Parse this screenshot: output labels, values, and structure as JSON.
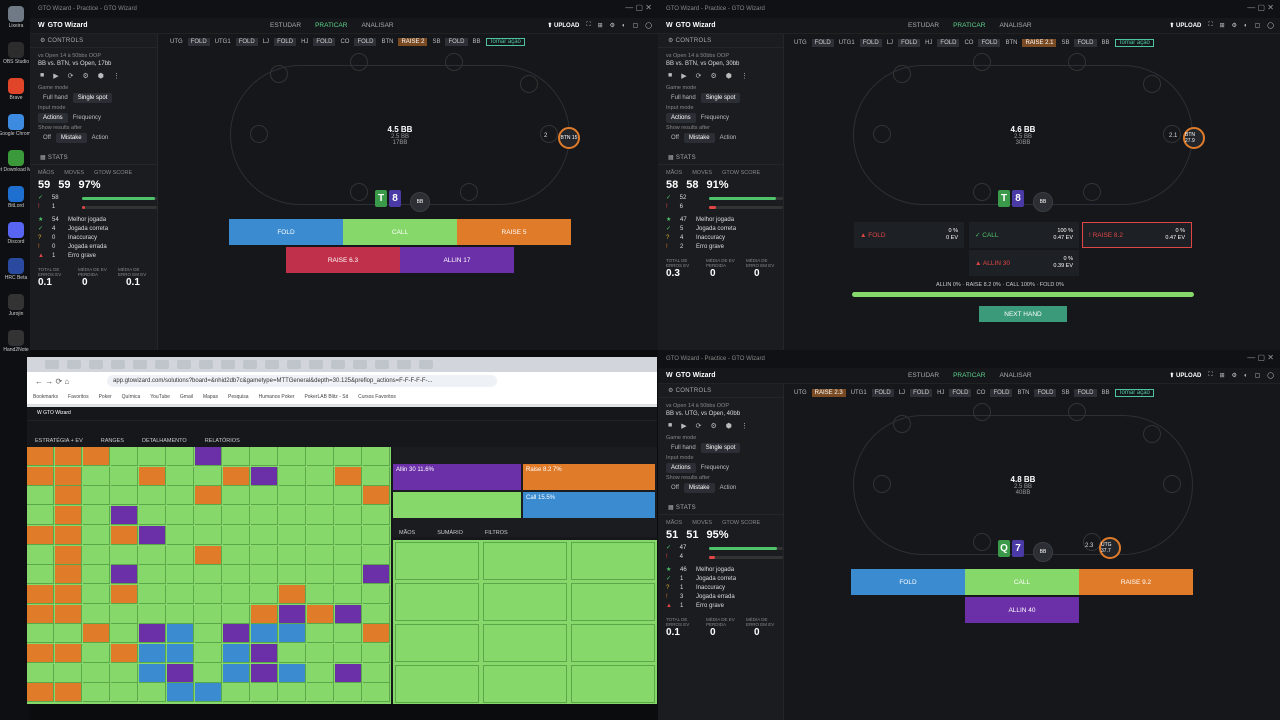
{
  "desktop_icons": [
    {
      "label": "Lixeira",
      "icon": "trash-icon",
      "color": "#6f7a86"
    },
    {
      "label": "OBS Studio",
      "icon": "obs-icon",
      "color": "#2c2c2c"
    },
    {
      "label": "Brave",
      "icon": "brave-icon",
      "color": "#e0452a"
    },
    {
      "label": "Google Chrome",
      "icon": "chrome-icon",
      "color": "#3d8be0"
    },
    {
      "label": "Internet Download Manager",
      "icon": "idm-icon",
      "color": "#3a9a3a"
    },
    {
      "label": "BitLord",
      "icon": "bitlord-icon",
      "color": "#1f6fd0"
    },
    {
      "label": "Discord",
      "icon": "discord-icon",
      "color": "#5865f2"
    },
    {
      "label": "HRC Beta",
      "icon": "hrc-icon",
      "color": "#2a4aa0"
    },
    {
      "label": "Jurojin",
      "icon": "jurojin-icon",
      "color": "#333"
    },
    {
      "label": "Hand2Note",
      "icon": "hand2note-icon",
      "color": "#333"
    }
  ],
  "app": {
    "window_title": "GTO Wizard - Practice - GTO Wizard",
    "logo": "GTO Wizard",
    "nav": [
      "ESTUDAR",
      "PRATICAR",
      "ANALISAR"
    ],
    "upload": "UPLOAD",
    "controls": "CONTROLS",
    "game_mode_label": "Game mode",
    "full_hand": "Full hand",
    "single_spot": "Single spot",
    "input_mode_label": "Input mode",
    "actions": "Actions",
    "frequency": "Frequency",
    "show_after_label": "Show results after",
    "off": "Off",
    "mistake": "Mistake",
    "action": "Action",
    "stats": "STATS",
    "maos": "MÃOS",
    "moves": "MOVES",
    "score": "GTOW SCORE",
    "labels": [
      "Melhor jogada",
      "Jogada correta",
      "Inaccuracy",
      "Jogada errada",
      "Erro grave"
    ],
    "bottom_labels": [
      "TOTAL DE ERROS EV",
      "MÉDIA DE EV PERDIDA",
      "MÉDIA DE ERRO EM EV"
    ]
  },
  "windows": [
    {
      "subtitle1": "vs Open 14 à 50bbs OOP",
      "subtitle2": "BB vs. BTN, vs Open, 17bb",
      "positions": [
        [
          "UTG",
          "FOLD"
        ],
        [
          "UTG1",
          "FOLD"
        ],
        [
          "LJ",
          "FOLD"
        ],
        [
          "HJ",
          "FOLD"
        ],
        [
          "CO",
          "FOLD"
        ],
        [
          "BTN",
          "RAISE 2"
        ],
        [
          "SB",
          "FOLD"
        ],
        [
          "BB",
          "Tomar ação"
        ]
      ],
      "stats": {
        "hands": "59",
        "moves": "59",
        "score": "97%",
        "good": "58",
        "bad": "1",
        "counts": [
          "54",
          "4",
          "0",
          "0",
          "1"
        ],
        "bottom": [
          "0.1",
          "0",
          "0.1"
        ]
      },
      "pot": "4.5 BB",
      "pot2": "2.5 BB",
      "pot3": "17BB",
      "hero_stack": "8 16",
      "villain": "BTN 15",
      "villain_bet": "2",
      "cards": [
        "T",
        "8"
      ],
      "buttons": [
        "FOLD",
        "CALL",
        "RAISE 5",
        "RAISE 6.3",
        "ALLIN 17"
      ]
    },
    {
      "subtitle1": "vs Open 14 à 50bbs OOP",
      "subtitle2": "BB vs. BTN, vs Open, 30bb",
      "positions": [
        [
          "UTG",
          "FOLD"
        ],
        [
          "UTG1",
          "FOLD"
        ],
        [
          "LJ",
          "FOLD"
        ],
        [
          "HJ",
          "FOLD"
        ],
        [
          "CO",
          "FOLD"
        ],
        [
          "BTN",
          "RAISE 2.1"
        ],
        [
          "SB",
          "FOLD"
        ],
        [
          "BB",
          "Tomar ação"
        ]
      ],
      "stats": {
        "hands": "58",
        "moves": "58",
        "score": "91%",
        "good": "52",
        "bad": "6",
        "counts": [
          "47",
          "5",
          "4",
          "2"
        ],
        "bottom": [
          "0.3",
          "0",
          "0"
        ]
      },
      "pot": "4.6 BB",
      "pot2": "2.5 BB",
      "pot3": "30BB",
      "villain": "BTN 27.9",
      "villain_bet": "2.1",
      "cards": [
        "T",
        "8"
      ],
      "results": [
        {
          "label": "FOLD",
          "freq": "0 %",
          "ev": "0 EV"
        },
        {
          "label": "CALL",
          "freq": "100 %",
          "ev": "0.47 EV"
        },
        {
          "label": "RAISE 8.2",
          "freq": "0 %",
          "ev": "0.47 EV"
        },
        {
          "label": "ALLIN 30",
          "freq": "0 %",
          "ev": "0.39 EV"
        }
      ],
      "summary": "ALLIN 0% · RAISE 8.2 0% · CALL 100% · FOLD 0%",
      "next": "NEXT HAND"
    },
    {
      "subtitle1": "vs Open 14 à 50bbs OOP",
      "subtitle2": "BB vs. UTG, vs Open, 40bb",
      "positions": [
        [
          "UTG",
          "RAISE 2.3"
        ],
        [
          "UTG1",
          "FOLD"
        ],
        [
          "LJ",
          "FOLD"
        ],
        [
          "HJ",
          "FOLD"
        ],
        [
          "CO",
          "FOLD"
        ],
        [
          "BTN",
          "FOLD"
        ],
        [
          "SB",
          "FOLD"
        ],
        [
          "BB",
          "Tomar ação"
        ]
      ],
      "stats": {
        "hands": "51",
        "moves": "51",
        "score": "95%",
        "good": "47",
        "bad": "4",
        "counts": [
          "46",
          "1",
          "1",
          "3",
          "1"
        ],
        "bottom": [
          "0.1",
          "0",
          "0"
        ]
      },
      "pot": "4.8 BB",
      "pot2": "2.5 BB",
      "pot3": "40BB",
      "villain": "UTG 37.7",
      "villain_bet": "2.3",
      "cards": [
        "Q",
        "7"
      ],
      "buttons": [
        "FOLD",
        "CALL",
        "RAISE 9.2",
        "ALLIN 40"
      ]
    }
  ],
  "browser": {
    "url": "app.gtowizard.com/solutions?board=&nhid2db7c&gametype=MTTGeneral&depth=30.125&preflop_actions=F-F-F-F-F-...",
    "bookmarks": [
      "Bookmarks",
      "Favoritos",
      "Poker",
      "Química",
      "YouTube",
      "Gmail",
      "Mapas",
      "Pesquisa",
      "Humanos Poker",
      "",
      "PokerLAB Blitz - Sit",
      "",
      "Cursos Favoritos"
    ],
    "tabs": [
      "ESTRATÉGIA + EV",
      "RANGES",
      "DETALHAMENTO",
      "RELATÓRIOS"
    ],
    "side_tabs": [
      "MÃOS",
      "SUMÁRIO",
      "FILTROS"
    ],
    "strategy": [
      {
        "label": "Allin 30",
        "pct": "11.6%"
      },
      {
        "label": "Raise 8.2",
        "pct": "7%"
      },
      {
        "label": "Call",
        "pct": "15.5%"
      }
    ]
  }
}
